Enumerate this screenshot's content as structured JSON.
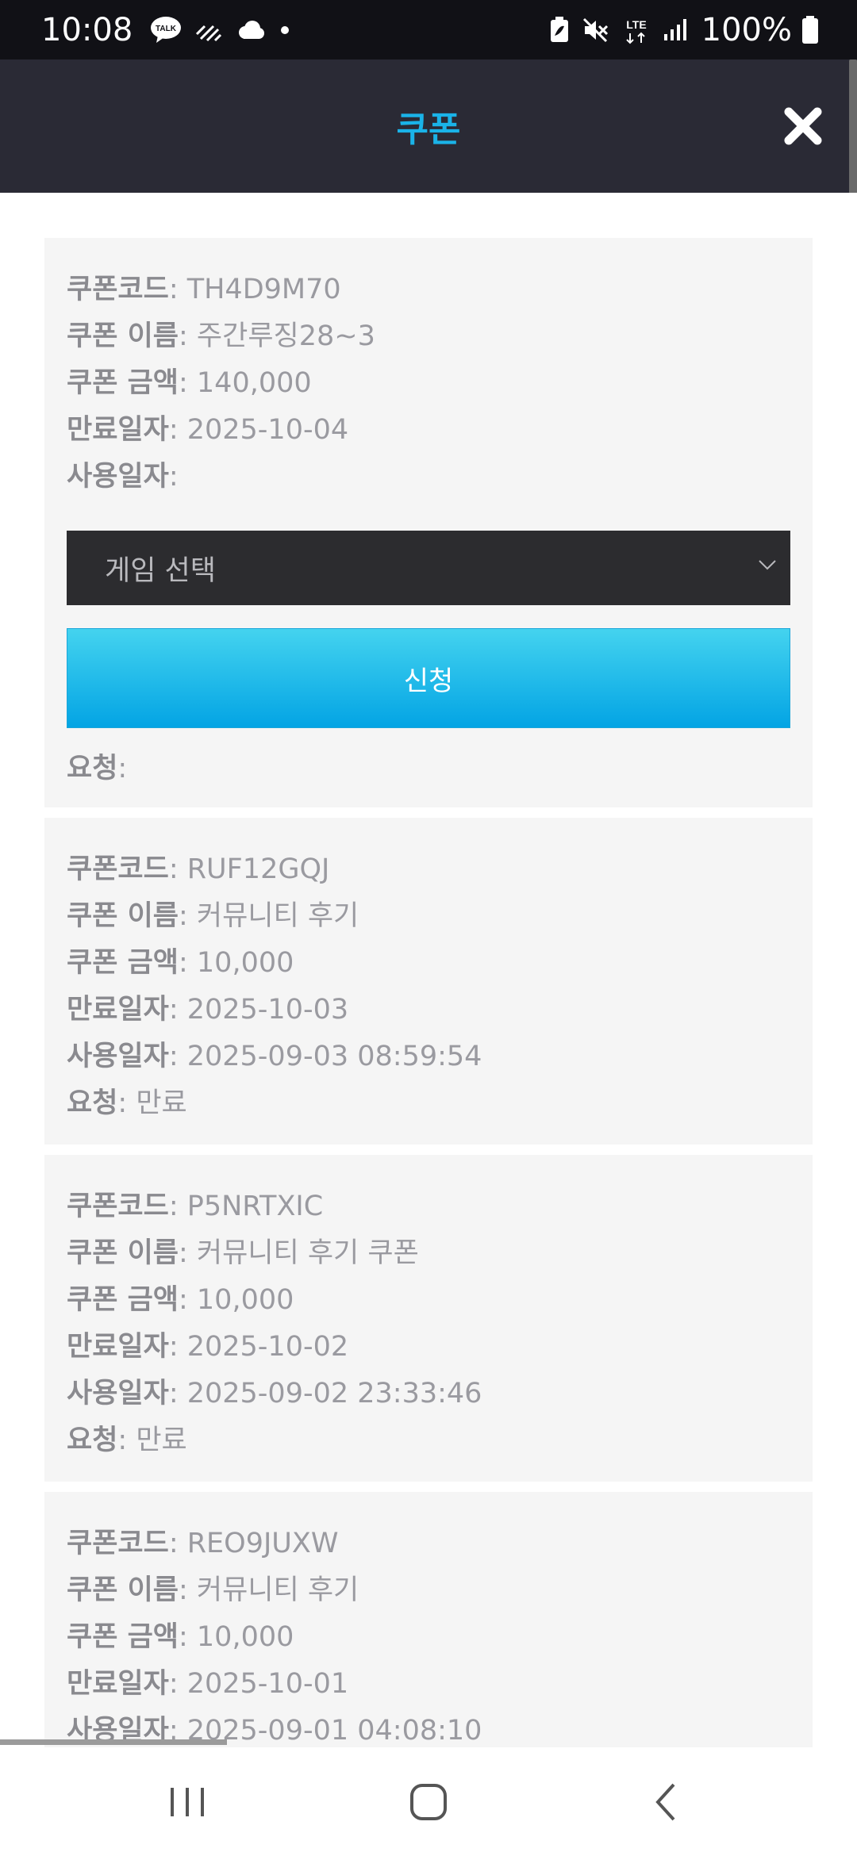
{
  "status_bar": {
    "time": "10:08",
    "talk_icon_label": "TALK",
    "network_label": "LTE",
    "battery_percent": "100%",
    "icons": [
      "talk-icon",
      "nfc-icon",
      "cloud-icon",
      "dot-icon",
      "battery-saver-icon",
      "mute-icon",
      "lte-icon",
      "signal-icon",
      "battery-icon"
    ]
  },
  "header": {
    "title": "쿠폰",
    "close_icon": "close-icon"
  },
  "labels": {
    "code": "쿠폰코드",
    "name": "쿠폰 이름",
    "amount": "쿠폰 금액",
    "expiry": "만료일자",
    "used": "사용일자",
    "request": "요청"
  },
  "coupons": [
    {
      "code": ": TH4D9M70",
      "name": ": 주간루징28~3",
      "amount": ": 140,000",
      "expiry": ": 2025-10-04",
      "used": ":",
      "game_select_placeholder": "게임 선택",
      "apply_label": "신청",
      "request": ":"
    },
    {
      "code": ": RUF12GQJ",
      "name": ": 커뮤니티 후기",
      "amount": ": 10,000",
      "expiry": ": 2025-10-03",
      "used": ": 2025-09-03 08:59:54",
      "request": ": 만료"
    },
    {
      "code": ": P5NRTXIC",
      "name": ": 커뮤니티 후기 쿠폰",
      "amount": ": 10,000",
      "expiry": ": 2025-10-02",
      "used": ": 2025-09-02 23:33:46",
      "request": ": 만료"
    },
    {
      "code": ": REO9JUXW",
      "name": ": 커뮤니티 후기",
      "amount": ": 10,000",
      "expiry": ": 2025-10-01",
      "used": ": 2025-09-01 04:08:10"
    }
  ],
  "nav_bar": {
    "icons": [
      "recent-apps-icon",
      "home-icon",
      "back-icon"
    ]
  },
  "colors": {
    "accent": "#1ab3e8",
    "header_bg": "#2a2a35",
    "card_bg": "#f5f5f5",
    "select_bg": "#2c2c2f"
  }
}
